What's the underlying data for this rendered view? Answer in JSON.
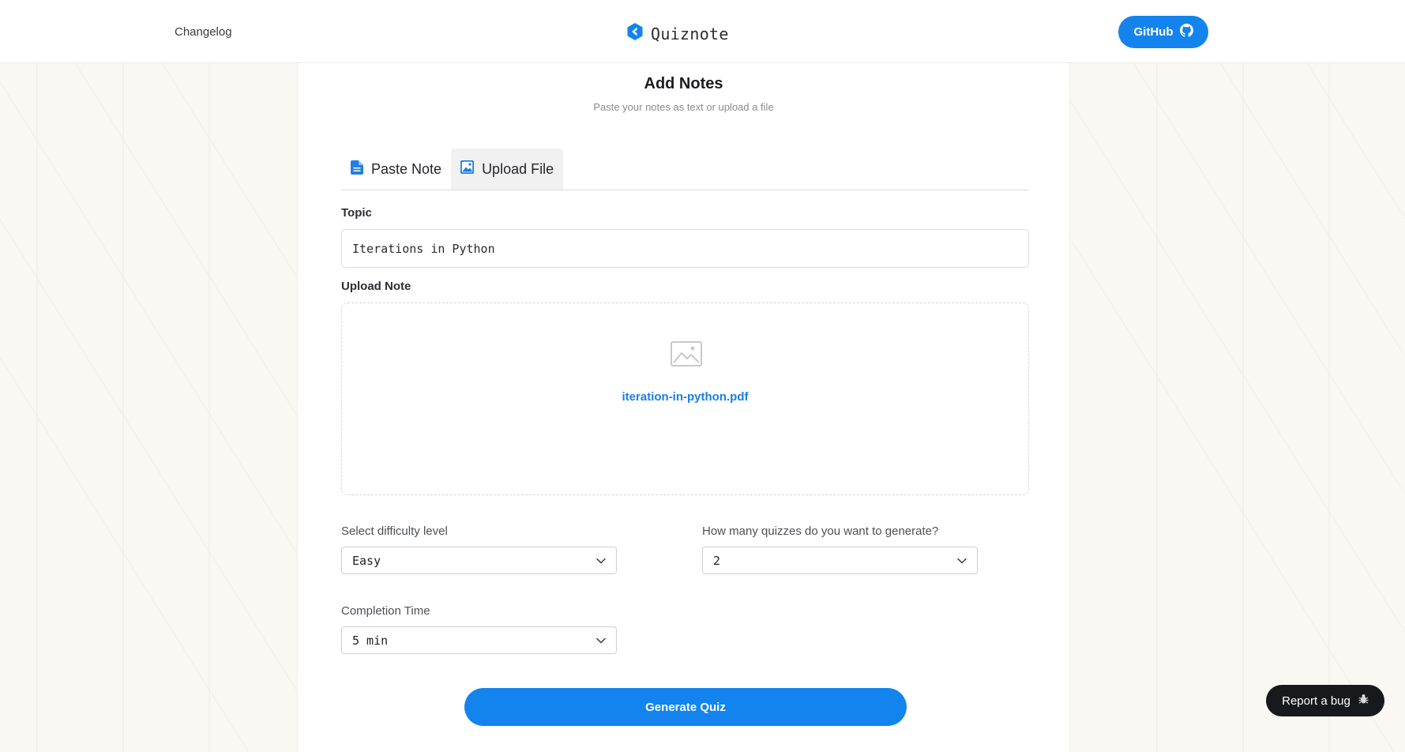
{
  "header": {
    "changelog_label": "Changelog",
    "brand_name": "Quiznote",
    "github_label": "GitHub"
  },
  "main": {
    "title": "Add Notes",
    "subtitle": "Paste your notes as text or upload a file",
    "tabs": [
      {
        "label": "Paste Note",
        "icon": "document-icon",
        "active": false
      },
      {
        "label": "Upload File",
        "icon": "image-icon",
        "active": true
      }
    ],
    "topic_label": "Topic",
    "topic_value": "Iterations in Python",
    "upload_label": "Upload Note",
    "uploaded_file": "iteration-in-python.pdf",
    "difficulty_label": "Select difficulty level",
    "difficulty_value": "Easy",
    "quiz_count_label": "How many quizzes do you want to generate?",
    "quiz_count_value": "2",
    "completion_label": "Completion Time",
    "completion_value": "5 min",
    "generate_label": "Generate Quiz"
  },
  "report_bug_label": "Report a bug",
  "colors": {
    "accent": "#1384ee",
    "background": "#f9f8f2",
    "report_button": "#18191c",
    "file_link": "#1a7fe3"
  }
}
